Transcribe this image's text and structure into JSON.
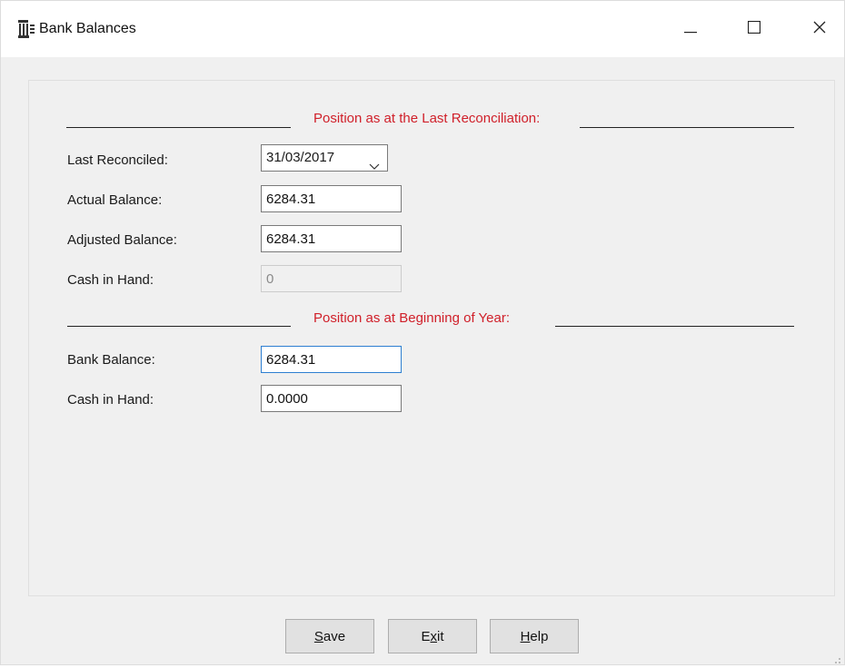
{
  "window": {
    "title": "Bank Balances"
  },
  "sections": {
    "last_reconciliation": {
      "heading": "Position as at the Last Reconciliation:"
    },
    "beginning_of_year": {
      "heading": "Position as at Beginning of Year:"
    }
  },
  "fields": {
    "last_reconciled": {
      "label": "Last Reconciled:",
      "value": "31/03/2017"
    },
    "actual_balance": {
      "label": "Actual Balance:",
      "value": "6284.31"
    },
    "adjusted_balance": {
      "label": "Adjusted Balance:",
      "value": "6284.31"
    },
    "cash_in_hand_recon": {
      "label": "Cash in Hand:",
      "value": "0"
    },
    "bank_balance": {
      "label": "Bank Balance:",
      "value": "6284.31"
    },
    "cash_in_hand_year": {
      "label": "Cash in Hand:",
      "value": "0.0000"
    }
  },
  "buttons": {
    "save": {
      "mnemonic": "S",
      "rest": "ave"
    },
    "exit": {
      "pre": "E",
      "mnemonic": "x",
      "rest": "it"
    },
    "help": {
      "mnemonic": "H",
      "rest": "elp"
    }
  },
  "icons": {
    "app": "bank-building-icon",
    "minimize": "minimize-icon",
    "maximize": "maximize-icon",
    "close": "close-icon",
    "dropdown": "chevron-down-icon"
  },
  "colors": {
    "section_heading": "#d0202a",
    "focus_border": "#2d7fd1",
    "window_bg": "#f0f0f0"
  }
}
